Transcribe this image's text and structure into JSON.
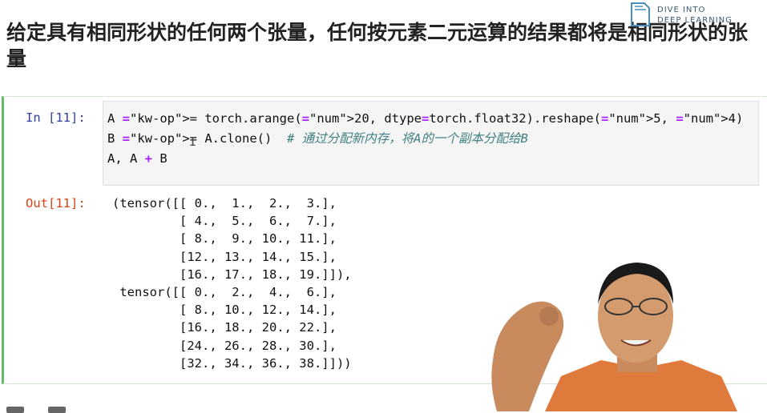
{
  "heading": {
    "text": "给定具有相同形状的任何两个张量，任何按元素二元运算的结果都将是相同形状的张量"
  },
  "logo": {
    "line1": "DIVE INTO",
    "line2": "DEEP LEARNING",
    "icon": "book-icon"
  },
  "cell": {
    "in_prompt": "In [11]:",
    "out_prompt": "Out[11]:",
    "code_lines": [
      "A = torch.arange(20, dtype=torch.float32).reshape(5, 4)",
      "B = A.clone()  # 通过分配新内存，将A的一个副本分配给B",
      "A, A + B"
    ],
    "output_lines": [
      "(tensor([[ 0.,  1.,  2.,  3.],",
      "         [ 4.,  5.,  6.,  7.],",
      "         [ 8.,  9., 10., 11.],",
      "         [12., 13., 14., 15.],",
      "         [16., 17., 18., 19.]]),",
      " tensor([[ 0.,  2.,  4.,  6.],",
      "         [ 8., 10., 12., 14.],",
      "         [16., 18., 20., 22.],",
      "         [24., 26., 28., 30.],",
      "         [32., 34., 36., 38.]]))"
    ]
  },
  "colors": {
    "cell_border": "#66bb6a",
    "in_prompt": "#303f9f",
    "out_prompt": "#d84315",
    "keyword_operator": "#aa22ff",
    "number": "#008000",
    "comment": "#408080"
  },
  "cursor_icon": "text-cursor-icon"
}
